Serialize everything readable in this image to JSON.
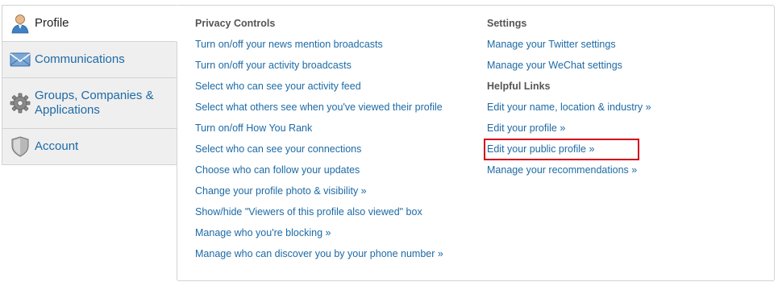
{
  "tabs": [
    {
      "label": "Profile",
      "icon": "person-icon"
    },
    {
      "label": "Communications",
      "icon": "envelope-icon"
    },
    {
      "label": "Groups, Companies & Applications",
      "icon": "gear-icon"
    },
    {
      "label": "Account",
      "icon": "shield-icon"
    }
  ],
  "privacy": {
    "title": "Privacy Controls",
    "links": [
      "Turn on/off your news mention broadcasts",
      "Turn on/off your activity broadcasts",
      "Select who can see your activity feed",
      "Select what others see when you've viewed their profile",
      "Turn on/off How You Rank",
      "Select who can see your connections",
      "Choose who can follow your updates",
      "Change your profile photo & visibility »",
      "Show/hide \"Viewers of this profile also viewed\" box",
      "Manage who you're blocking »",
      "Manage who can discover you by your phone number »"
    ]
  },
  "settings": {
    "title": "Settings",
    "links": [
      "Manage your Twitter settings",
      "Manage your WeChat settings"
    ]
  },
  "helpful": {
    "title": "Helpful Links",
    "links": [
      "Edit your name, location & industry »",
      "Edit your profile »",
      "Edit your public profile »",
      "Manage your recommendations »"
    ]
  },
  "colors": {
    "link": "#1d6aa5",
    "highlight": "#d0021b",
    "tab_bg": "#efefef"
  }
}
